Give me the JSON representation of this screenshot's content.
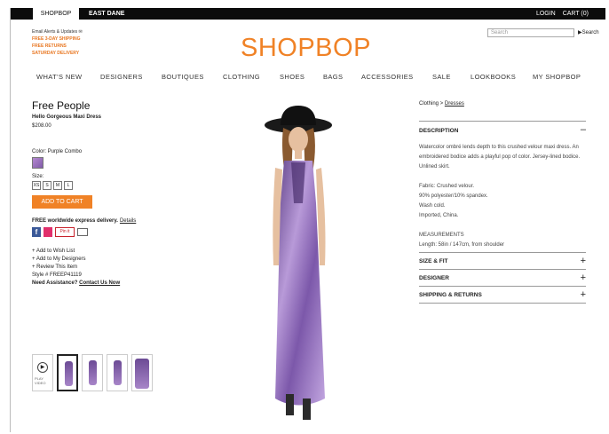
{
  "topbar": {
    "tabs": [
      "SHOPBOP",
      "EAST DANE"
    ],
    "login": "LOGIN",
    "cart": "CART (0)"
  },
  "promo": {
    "alerts": "Email Alerts & Updates",
    "lines": [
      "FREE 3-DAY SHIPPING",
      "FREE RETURNS",
      "SATURDAY DELIVERY"
    ]
  },
  "logo": "SHOPBOP",
  "search": {
    "placeholder": "Search",
    "button": "Search"
  },
  "nav": [
    "WHAT'S NEW",
    "DESIGNERS",
    "BOUTIQUES",
    "CLOTHING",
    "SHOES",
    "BAGS",
    "ACCESSORIES",
    "SALE",
    "LOOKBOOKS",
    "MY SHOPBOP"
  ],
  "product": {
    "brand": "Free People",
    "name": "Hello Gorgeous Maxi Dress",
    "price": "$208.00",
    "color_label": "Color: Purple Combo",
    "size_label": "Size:",
    "sizes": [
      "XS",
      "S",
      "M",
      "L"
    ],
    "add_to_cart": "ADD TO CART",
    "delivery": "FREE worldwide express delivery.",
    "details": "Details",
    "pin_label": "Pin it",
    "links": [
      "+ Add to Wish List",
      "+ Add to My Designers",
      "+ Review This Item"
    ],
    "style": "Style # FREEP41119",
    "assist": "Need Assistance?",
    "contact": "Contact Us Now",
    "play_label": "PLAY VIDEO"
  },
  "right": {
    "crumb_parent": "Clothing",
    "crumb_sep": " > ",
    "crumb_child": "Dresses",
    "description_head": "DESCRIPTION",
    "description_text": "Watercolor ombré lends depth to this crushed velour maxi dress. An embroidered bodice adds a playful pop of color. Jersey-lined bodice. Unlined skirt.",
    "fabric": [
      "Fabric: Crushed velour.",
      "90% polyester/10% spandex.",
      "Wash cold.",
      "Imported, China."
    ],
    "measurements_head": "MEASUREMENTS",
    "measurements": "Length: 58in / 147cm, from shoulder",
    "sections": [
      "SIZE & FIT",
      "DESIGNER",
      "SHIPPING & RETURNS"
    ]
  },
  "colors": {
    "accent": "#f08226",
    "swatch": "#9b73c4"
  }
}
